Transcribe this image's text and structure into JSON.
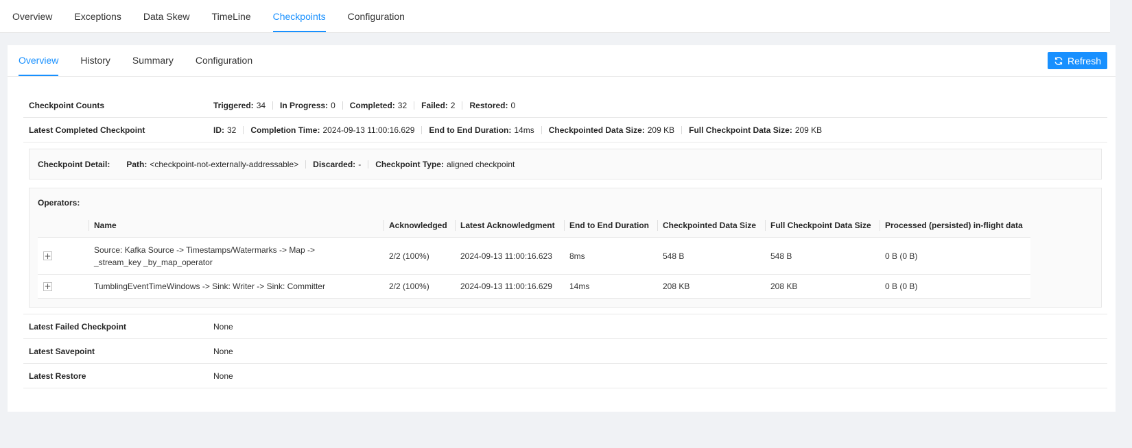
{
  "top_tabs": [
    "Overview",
    "Exceptions",
    "Data Skew",
    "TimeLine",
    "Checkpoints",
    "Configuration"
  ],
  "top_tab_active": 4,
  "sub_tabs": [
    "Overview",
    "History",
    "Summary",
    "Configuration"
  ],
  "sub_tab_active": 0,
  "refresh_label": "Refresh",
  "counts": {
    "label": "Checkpoint Counts",
    "items": [
      {
        "k": "Triggered:",
        "v": "34"
      },
      {
        "k": "In Progress:",
        "v": "0"
      },
      {
        "k": "Completed:",
        "v": "32"
      },
      {
        "k": "Failed:",
        "v": "2"
      },
      {
        "k": "Restored:",
        "v": "0"
      }
    ]
  },
  "latest_completed": {
    "label": "Latest Completed Checkpoint",
    "items": [
      {
        "k": "ID:",
        "v": "32"
      },
      {
        "k": "Completion Time:",
        "v": "2024-09-13 11:00:16.629"
      },
      {
        "k": "End to End Duration:",
        "v": "14ms"
      },
      {
        "k": "Checkpointed Data Size:",
        "v": "209 KB"
      },
      {
        "k": "Full Checkpoint Data Size:",
        "v": "209 KB"
      }
    ]
  },
  "detail": {
    "label": "Checkpoint Detail:",
    "items": [
      {
        "k": "Path:",
        "v": "<checkpoint-not-externally-addressable>"
      },
      {
        "k": "Discarded:",
        "v": "-"
      },
      {
        "k": "Checkpoint Type:",
        "v": "aligned checkpoint"
      }
    ]
  },
  "operators": {
    "title": "Operators:",
    "columns": [
      "",
      "Name",
      "Acknowledged",
      "Latest Acknowledgment",
      "End to End Duration",
      "Checkpointed Data Size",
      "Full Checkpoint Data Size",
      "Processed (persisted) in-flight data"
    ],
    "rows": [
      [
        "Source: Kafka Source -> Timestamps/Watermarks -> Map -> _stream_key _by_map_operator",
        "2/2 (100%)",
        "2024-09-13 11:00:16.623",
        "8ms",
        "548 B",
        "548 B",
        "0 B (0 B)"
      ],
      [
        "TumblingEventTimeWindows -> Sink: Writer -> Sink: Committer",
        "2/2 (100%)",
        "2024-09-13 11:00:16.629",
        "14ms",
        "208 KB",
        "208 KB",
        "0 B (0 B)"
      ]
    ]
  },
  "bottom_rows": [
    {
      "label": "Latest Failed Checkpoint",
      "value": "None"
    },
    {
      "label": "Latest Savepoint",
      "value": "None"
    },
    {
      "label": "Latest Restore",
      "value": "None"
    }
  ]
}
